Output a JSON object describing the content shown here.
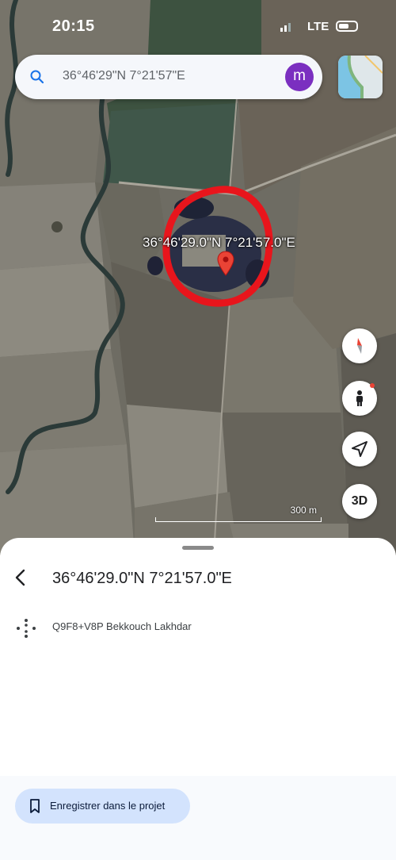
{
  "status_bar": {
    "time": "20:15",
    "network": "LTE"
  },
  "search": {
    "query": "36°46'29\"N 7°21'57\"E",
    "avatar_initial": "m",
    "avatar_color": "#7b2fc0"
  },
  "map": {
    "coordinate_label": "36°46'29.0\"N 7°21'57.0\"E",
    "scale_label": "300 m",
    "three_d_label": "3D",
    "pin_color": "#ea4335",
    "highlight_color": "#e8151c"
  },
  "sheet": {
    "title": "36°46'29.0\"N 7°21'57.0\"E",
    "plus_code": "Q9F8+V8P Bekkouch Lakhdar",
    "save_button": "Enregistrer dans le projet"
  },
  "icons": [
    "search-icon",
    "layers-icon",
    "compass-icon",
    "street-view-icon",
    "location-arrow-icon",
    "back-arrow-icon",
    "plus-code-icon",
    "bookmark-icon"
  ]
}
